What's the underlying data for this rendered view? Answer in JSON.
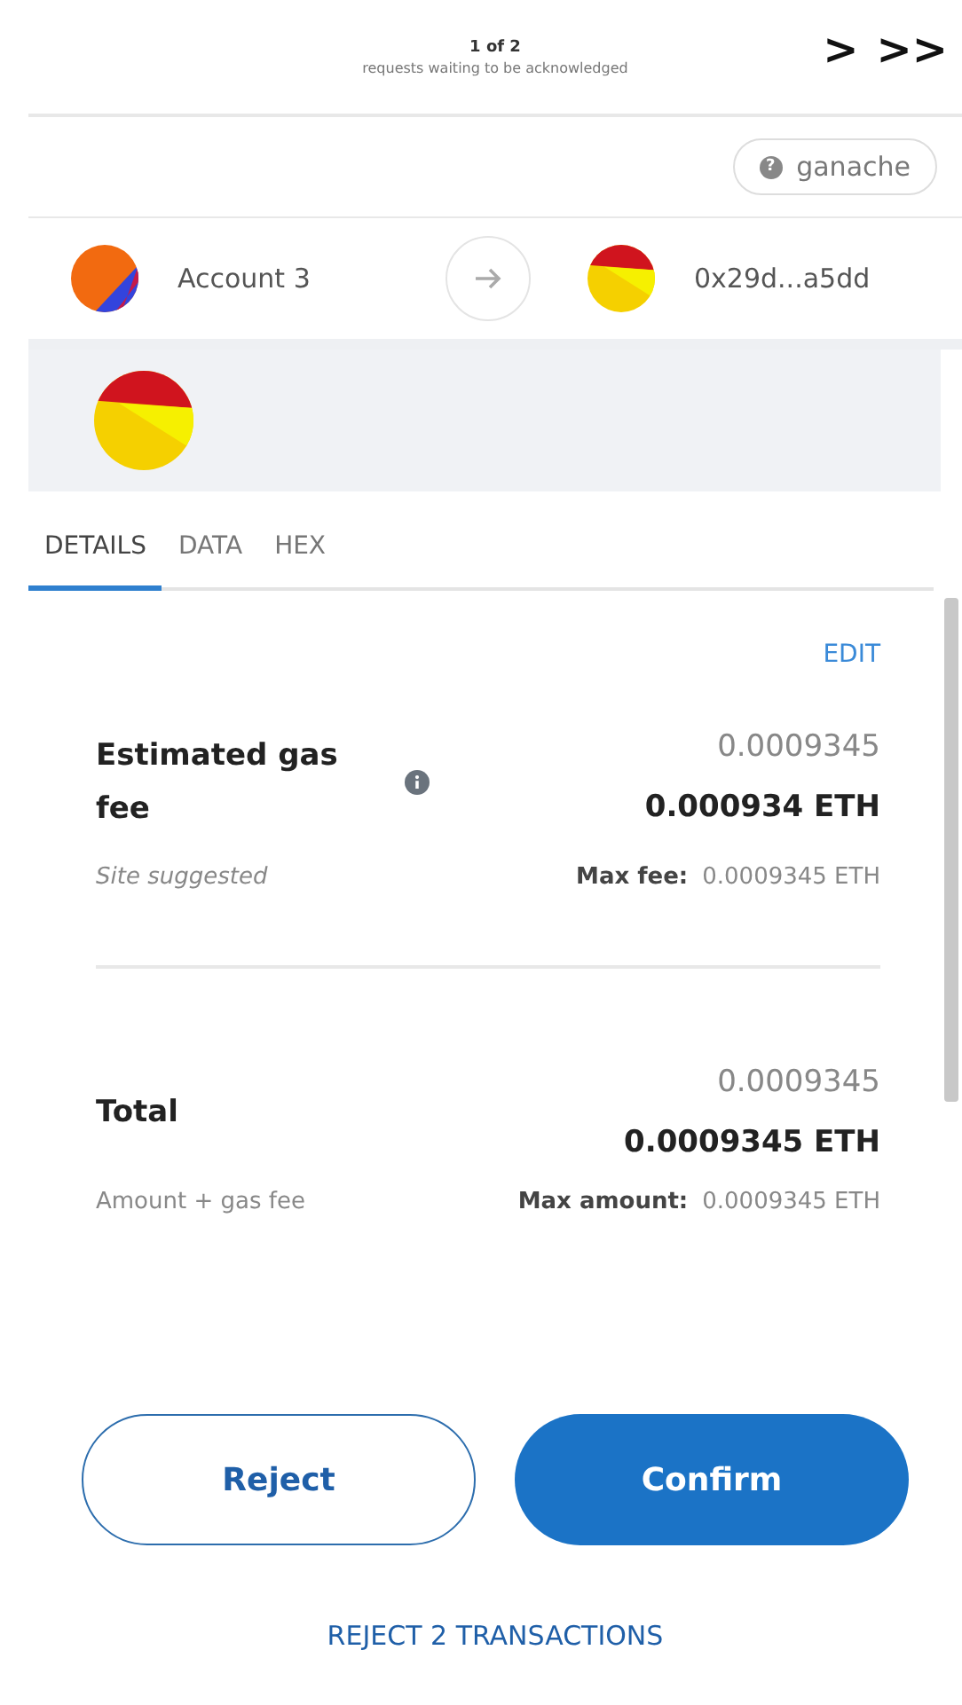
{
  "header": {
    "counter": "1 of 2",
    "subtitle": "requests waiting to be acknowledged",
    "next": ">",
    "last": ">>"
  },
  "network": {
    "icon": "?",
    "label": "ganache"
  },
  "sender": {
    "name": "Account 3"
  },
  "recipient": {
    "name": "0x29d...a5dd"
  },
  "tabs": [
    {
      "label": "DETAILS",
      "selected": true
    },
    {
      "label": "DATA",
      "selected": false
    },
    {
      "label": "HEX",
      "selected": false
    }
  ],
  "edit_link": "EDIT",
  "fees": [
    {
      "label": "Estimated gas fee",
      "info": true,
      "secondary": "0.0009345",
      "primary": "0.000934 ETH",
      "note": "Site suggested",
      "note_italic": true,
      "max_label": "Max fee:",
      "max_value": "0.0009345 ETH"
    },
    {
      "label": "Total",
      "info": false,
      "secondary": "0.0009345",
      "primary": "0.0009345 ETH",
      "note": "Amount + gas fee",
      "note_italic": false,
      "max_label": "Max amount:",
      "max_value": "0.0009345 ETH"
    }
  ],
  "buttons": [
    {
      "label": "Reject",
      "kind": "secondary"
    },
    {
      "label": "Confirm",
      "kind": "primary"
    }
  ],
  "reject_all": "REJECT 2 TRANSACTIONS"
}
